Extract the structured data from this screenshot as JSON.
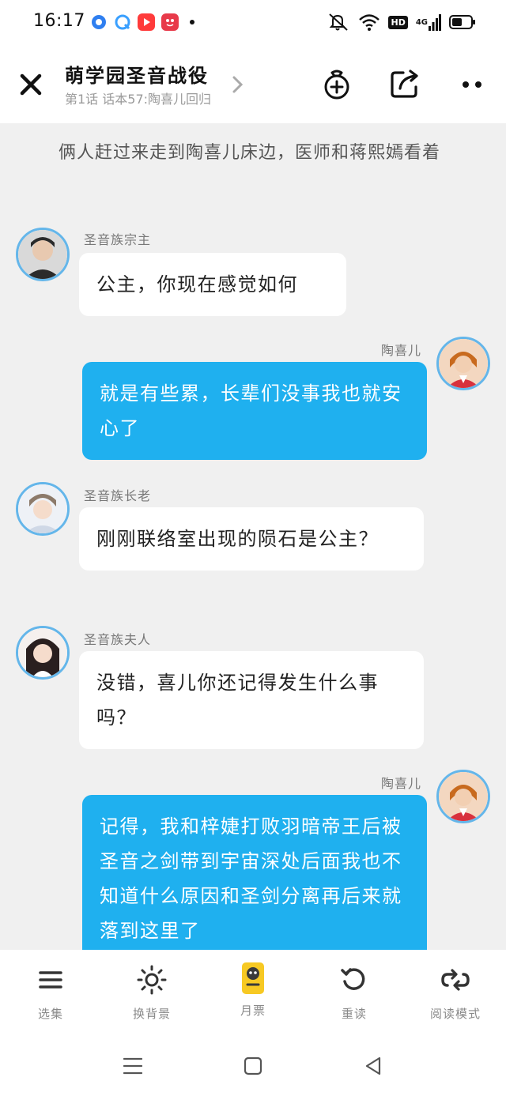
{
  "status": {
    "time": "16:17",
    "network": "4G",
    "hd": "HD"
  },
  "header": {
    "title": "萌学园圣音战役",
    "subtitle": "第1话 话本57:陶喜儿回归"
  },
  "chat": {
    "narration": "俩人赶过来走到陶喜儿床边，医师和蒋熙嫣看着",
    "messages": [
      {
        "side": "left",
        "name": "圣音族宗主",
        "text": "公主，你现在感觉如何"
      },
      {
        "side": "right",
        "name": "陶喜儿",
        "text": "就是有些累，长辈们没事我也就安心了"
      },
      {
        "side": "left",
        "name": "圣音族长老",
        "text": "刚刚联络室出现的陨石是公主？"
      },
      {
        "side": "left",
        "name": "圣音族夫人",
        "text": "没错，喜儿你还记得发生什么事吗？"
      },
      {
        "side": "right",
        "name": "陶喜儿",
        "text": "记得，我和梓婕打败羽暗帝王后被圣音之剑带到宇宙深处后面我也不知道什么原因和圣剑分离再后来就落到这里了"
      }
    ]
  },
  "toolbar": {
    "items": [
      {
        "label": "选集",
        "icon": "menu-icon"
      },
      {
        "label": "换背景",
        "icon": "sun-icon"
      },
      {
        "label": "月票",
        "icon": "ticket-icon"
      },
      {
        "label": "重读",
        "icon": "undo-icon"
      },
      {
        "label": "阅读模式",
        "icon": "loop-icon"
      }
    ]
  },
  "colors": {
    "accent": "#1fb0ef",
    "avatar_ring": "#64b6ea",
    "background": "#f0f0f0"
  }
}
